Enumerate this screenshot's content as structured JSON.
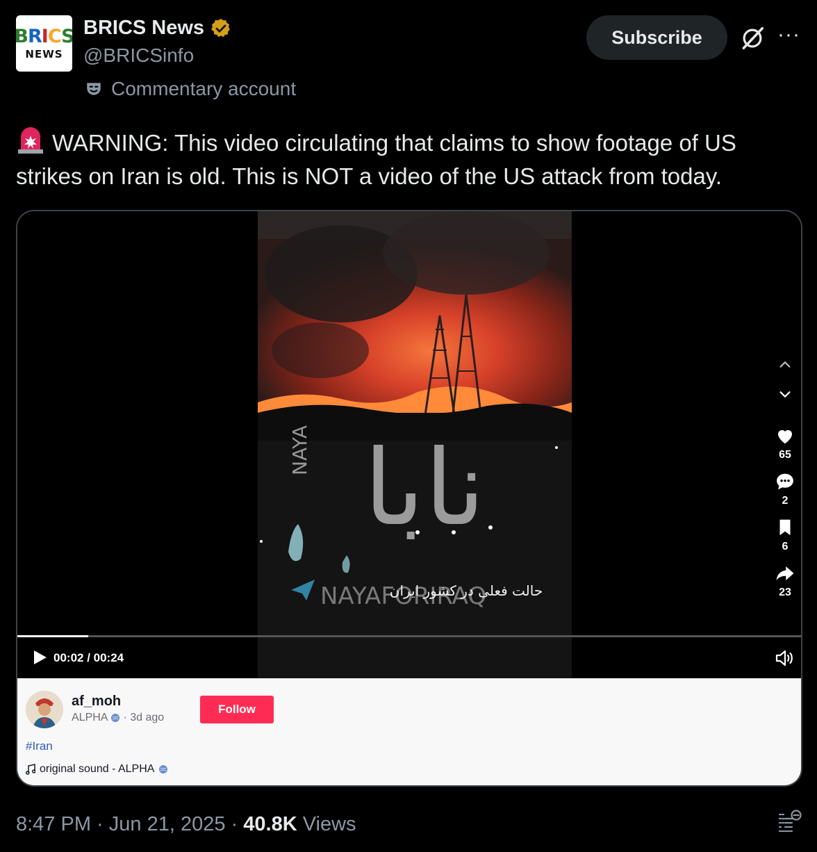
{
  "author": {
    "avatar_text_top": "BRICS",
    "avatar_text_bottom": "NEWS",
    "display_name": "BRICS News",
    "handle": "@BRICSinfo",
    "label": "Commentary account"
  },
  "actions": {
    "subscribe_label": "Subscribe",
    "more_label": "···"
  },
  "tweet": {
    "text": "WARNING: This video circulating that claims to show footage of US strikes on Iran is old. This is NOT a video of the US attack from today."
  },
  "video": {
    "overlay_arabic": "نابا",
    "watermark_latin": "NAYA",
    "caption_persian": "حالت فعلی در کشور ایران",
    "channel_watermark": "NAYAFORIRAQ",
    "likes": "65",
    "comments": "2",
    "saves": "6",
    "shares": "23",
    "time": "00:02 / 00:24",
    "progress_fraction": 0.09
  },
  "embed": {
    "username": "af_moh",
    "nickname": "ALPHA",
    "age": "· 3d ago",
    "follow_label": "Follow",
    "hashtag": "#Iran",
    "sound": "original sound - ALPHA"
  },
  "footer": {
    "timestamp": "8:47 PM · Jun 21, 2025 · ",
    "views_count": "40.8K",
    "views_label": " Views"
  },
  "colors": {
    "background": "#000000",
    "text": "#e7e9ea",
    "muted": "#8b98a5",
    "follow": "#fe2c55",
    "hashtag": "#2b5db9",
    "verified": "#d4a017"
  },
  "icons": [
    "verified-badge-icon",
    "mask-icon",
    "grok-icon",
    "more-icon",
    "siren-icon",
    "chevron-up-icon",
    "chevron-down-icon",
    "heart-icon",
    "comment-icon",
    "bookmark-icon",
    "share-icon",
    "play-icon",
    "volume-icon",
    "globe-icon",
    "music-note-icon",
    "grok-analyze-icon"
  ]
}
